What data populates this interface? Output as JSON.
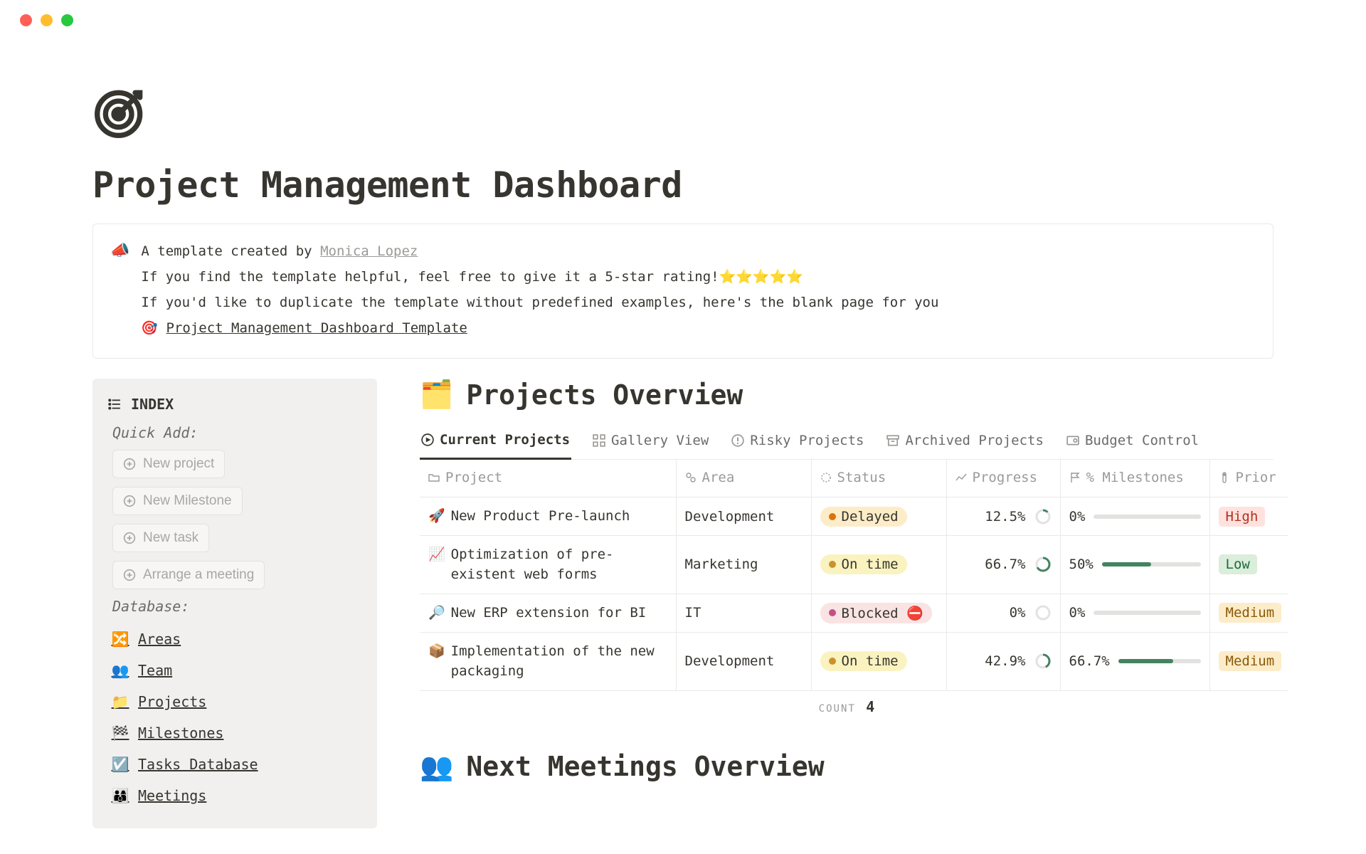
{
  "page": {
    "title": "Project Management Dashboard"
  },
  "callout": {
    "line1_prefix": "A template created by ",
    "author": "Monica Lopez",
    "line2": "If you find the template helpful, feel free to give it a 5-star rating!⭐⭐⭐⭐⭐",
    "line3": "If you'd like to duplicate the template without predefined examples, here's the blank page for you",
    "template_link": "Project Management Dashboard Template"
  },
  "index": {
    "title": "INDEX",
    "quick_add_label": "Quick Add:",
    "btn_new_project": "New project",
    "btn_new_milestone": "New Milestone",
    "btn_new_task": "New task",
    "btn_arrange_meeting": "Arrange a meeting",
    "database_label": "Database:",
    "link_areas": "Areas",
    "link_team": "Team",
    "link_projects": "Projects",
    "link_milestones": "Milestones",
    "link_tasks": "Tasks Database",
    "link_meetings": "Meetings"
  },
  "overview": {
    "title": "Projects Overview",
    "tabs": {
      "current": "Current Projects",
      "gallery": "Gallery View",
      "risky": "Risky Projects",
      "archived": "Archived Projects",
      "budget": "Budget Control"
    },
    "columns": {
      "project": "Project",
      "area": "Area",
      "status": "Status",
      "progress": "Progress",
      "milestones": "% Milestones",
      "priority": "Prior"
    },
    "rows": [
      {
        "emoji": "🚀",
        "name": "New Product Pre-launch",
        "area": "Development",
        "status": "Delayed",
        "status_class": "delayed",
        "progress": "12.5%",
        "progress_pct": 12.5,
        "milestones": "0%",
        "milestones_pct": 0,
        "priority": "High",
        "priority_class": "high"
      },
      {
        "emoji": "📈",
        "name": "Optimization of pre-existent web forms",
        "area": "Marketing",
        "status": "On time",
        "status_class": "ontime",
        "progress": "66.7%",
        "progress_pct": 66.7,
        "milestones": "50%",
        "milestones_pct": 50,
        "priority": "Low",
        "priority_class": "low"
      },
      {
        "emoji": "🔎",
        "name": "New ERP extension for BI",
        "area": "IT",
        "status": "Blocked",
        "status_class": "blocked",
        "status_extra": "⛔",
        "progress": "0%",
        "progress_pct": 0,
        "milestones": "0%",
        "milestones_pct": 0,
        "priority": "Medium",
        "priority_class": "medium"
      },
      {
        "emoji": "📦",
        "name": "Implementation of the new packaging",
        "area": "Development",
        "status": "On time",
        "status_class": "ontime",
        "progress": "42.9%",
        "progress_pct": 42.9,
        "milestones": "66.7%",
        "milestones_pct": 66.7,
        "priority": "Medium",
        "priority_class": "medium"
      }
    ],
    "count_label": "COUNT",
    "count_value": "4"
  },
  "meetings": {
    "title": "Next Meetings Overview"
  }
}
